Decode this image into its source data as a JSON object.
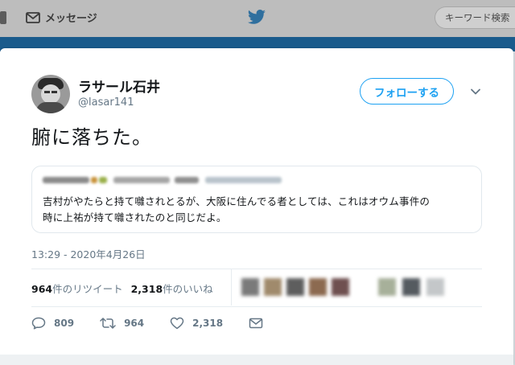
{
  "nav": {
    "messages_label": "メッセージ",
    "search_placeholder": "キーワード検索",
    "icons": [
      "home-icon",
      "envelope-icon",
      "twitter-bird-icon"
    ]
  },
  "tweet": {
    "display_name": "ラサール石井",
    "username": "@lasar141",
    "follow_label": "フォローする",
    "text": "腑に落ちた。",
    "quote": {
      "line1": "吉村がやたらと持て囃されとるが、大阪に住んでる者としては、これはオウム事件の",
      "line2": "時に上祐が持て囃されたのと同じだよ。"
    },
    "timestamp": "13:29 - 2020年4月26日",
    "stats": {
      "retweets_count": "964",
      "retweets_label": "件のリツイート",
      "likes_count": "2,318",
      "likes_label": "件のいいね"
    },
    "actions": {
      "replies": "809",
      "retweets": "964",
      "likes": "2,318"
    }
  },
  "colors": {
    "accent": "#1da1f2",
    "text": "#14171a",
    "muted": "#657786",
    "banner": "#1a5b8c"
  }
}
